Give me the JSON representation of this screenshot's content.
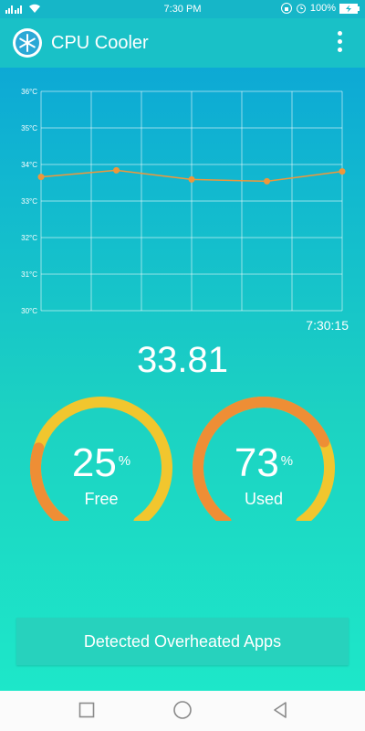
{
  "status_bar": {
    "time": "7:30 PM",
    "battery": "100%",
    "icons": [
      "signal-icon",
      "wifi-icon",
      "lock-icon",
      "alarm-icon",
      "battery-charging-icon"
    ]
  },
  "app_bar": {
    "title": "CPU Cooler",
    "logo_icon": "snowflake-icon",
    "menu_icon": "more-vert-icon"
  },
  "chart_data": {
    "type": "line",
    "ylim": [
      30,
      36
    ],
    "y_ticks": [
      "36°C",
      "35°C",
      "34°C",
      "33°C",
      "32°C",
      "31°C",
      "30°C"
    ],
    "grid": true,
    "values": [
      33.66,
      33.84,
      33.59,
      33.54,
      33.81
    ],
    "time_label": "7:30:15",
    "line_color": "#f0973a"
  },
  "current_temp": "33.81",
  "gauges": [
    {
      "value": "25",
      "percent_sign": "%",
      "label": "Free",
      "fraction": 0.25
    },
    {
      "value": "73",
      "percent_sign": "%",
      "label": "Used",
      "fraction": 0.73
    }
  ],
  "action_button": {
    "label": "Detected Overheated Apps"
  },
  "colors": {
    "gauge_track": "#f1c62e",
    "gauge_fill": "#ee8e35"
  },
  "nav": {
    "icons": [
      "recent-apps-icon",
      "home-icon",
      "back-icon"
    ]
  }
}
